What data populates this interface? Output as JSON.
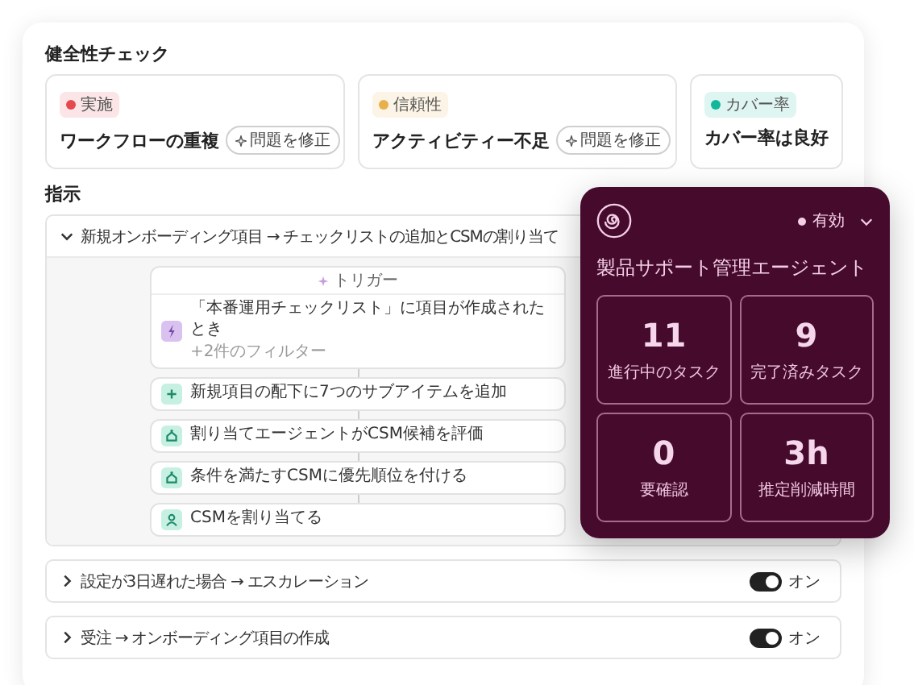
{
  "health_check": {
    "title": "健全性チェック",
    "items": [
      {
        "tag": "実施",
        "color": "#e5484d",
        "message": "ワークフローの重複",
        "action": "問題を修正"
      },
      {
        "tag": "信頼性",
        "color": "#e9b04a",
        "message": "アクティビティー不足",
        "action": "問題を修正"
      },
      {
        "tag": "カバー率",
        "color": "#12b89a",
        "message": "カバー率は良好"
      }
    ]
  },
  "instructions": {
    "title": "指示",
    "rules": [
      {
        "title": "新規オンボーディング項目 → チェックリストの追加とCSMの割り当て",
        "expanded": true,
        "flow": {
          "trigger_label": "トリガー",
          "trigger": {
            "text": "「本番運用チェックリスト」に項目が作成されたとき",
            "filters": "+2件のフィルター"
          },
          "steps": [
            {
              "kind": "add",
              "text": "新規項目の配下に7つのサブアイテムを追加"
            },
            {
              "kind": "agent",
              "text": "割り当てエージェントがCSM候補を評価"
            },
            {
              "kind": "agent",
              "text": "条件を満たすCSMに優先順位を付ける"
            },
            {
              "kind": "person",
              "text": "CSMを割り当てる"
            }
          ]
        }
      },
      {
        "title": "設定が3日遅れた場合 → エスカレーション",
        "expanded": false,
        "on": true,
        "toggle_label": "オン"
      },
      {
        "title": "受注 → オンボーディング項目の作成",
        "expanded": false,
        "on": true,
        "toggle_label": "オン"
      }
    ]
  },
  "agent_panel": {
    "status": "有効",
    "name": "製品サポート管理エージェント",
    "stats": [
      {
        "value": "11",
        "label": "進行中のタスク"
      },
      {
        "value": "9",
        "label": "完了済みタスク"
      },
      {
        "value": "0",
        "label": "要確認"
      },
      {
        "value": "3h",
        "label": "推定削減時間"
      }
    ]
  }
}
